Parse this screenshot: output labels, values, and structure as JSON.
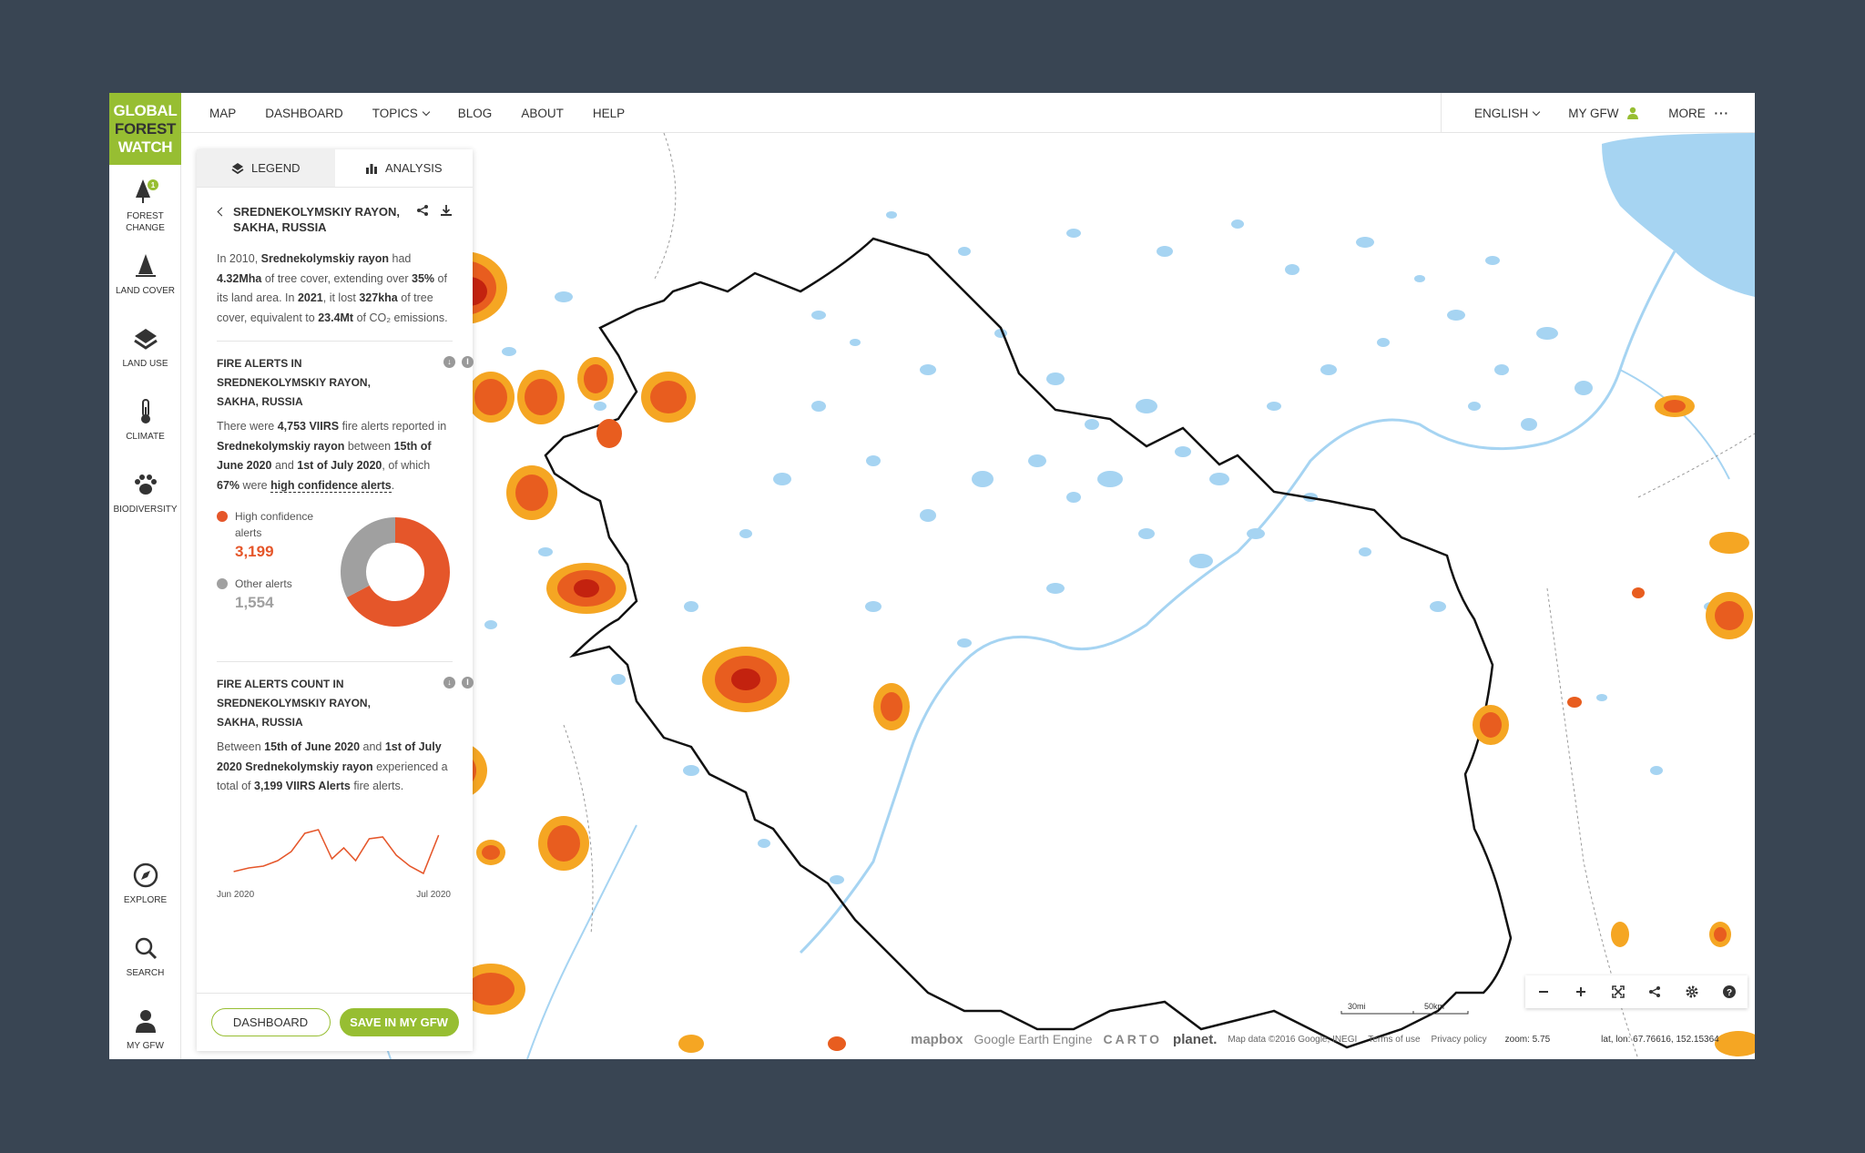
{
  "logo": {
    "line1": "GLOBAL",
    "line2": "FOREST",
    "line3": "WATCH"
  },
  "nav": {
    "links": [
      "MAP",
      "DASHBOARD",
      "TOPICS",
      "BLOG",
      "ABOUT",
      "HELP"
    ],
    "right": {
      "language": "ENGLISH",
      "my_gfw": "MY GFW",
      "more": "MORE"
    }
  },
  "sidebar": {
    "top": [
      {
        "label1": "FOREST",
        "label2": "CHANGE",
        "badge": "1",
        "icon": "tree-icon"
      },
      {
        "label1": "LAND COVER",
        "label2": "",
        "icon": "land-cover-icon"
      },
      {
        "label1": "LAND USE",
        "label2": "",
        "icon": "layers-icon"
      },
      {
        "label1": "CLIMATE",
        "label2": "",
        "icon": "thermometer-icon"
      },
      {
        "label1": "BIODIVERSITY",
        "label2": "",
        "icon": "paw-icon"
      }
    ],
    "bottom": [
      {
        "label": "EXPLORE",
        "icon": "compass-icon"
      },
      {
        "label": "SEARCH",
        "icon": "search-icon"
      },
      {
        "label": "MY GFW",
        "icon": "user-icon"
      }
    ]
  },
  "panel": {
    "tabs": {
      "legend": "LEGEND",
      "analysis": "ANALYSIS"
    },
    "location": {
      "line1": "SREDNEKOLYMSKIY RAYON,",
      "line2": "SAKHA, RUSSIA"
    },
    "summary": {
      "t1": "In 2010, ",
      "b1": "Srednekolymskiy rayon",
      "t2": " had ",
      "b2": "4.32Mha",
      "t3": " of tree cover, extending over ",
      "b3": "35%",
      "t4": " of its land area. In ",
      "b4": "2021",
      "t5": ", it lost ",
      "b5": "327kha",
      "t6": " of tree cover, equivalent to ",
      "b6": "23.4Mt",
      "t7": " of CO₂ emissions."
    },
    "fire_alerts": {
      "title": "FIRE ALERTS IN SREDNEKOLYMSKIY RAYON, SAKHA, RUSSIA",
      "t1": "There were ",
      "b1": "4,753 VIIRS",
      "t2": " fire alerts reported in ",
      "b2": "Srednekolymskiy rayon",
      "t3": " between ",
      "b3": "15th of June 2020",
      "t4": " and ",
      "b4": "1st of July 2020",
      "t5": ", of which ",
      "b5": "67%",
      "t6": " were ",
      "b6": "high confidence alerts",
      "t7": ".",
      "legend": {
        "high_label_1": "High confidence",
        "high_label_2": "alerts",
        "high_value": "3,199",
        "other_label": "Other alerts",
        "other_value": "1,554"
      },
      "donut": {
        "high": 3199,
        "other": 1554
      }
    },
    "fire_count": {
      "title": "FIRE ALERTS COUNT IN SREDNEKOLYMSKIY RAYON, SAKHA, RUSSIA",
      "t1": "Between ",
      "b1": "15th of June 2020",
      "t2": " and ",
      "b2": "1st of July 2020 Srednekolymskiy rayon",
      "t3": " experienced a total of ",
      "r1": "3,199",
      "b3": "VIIRS Alerts",
      "t4": " fire alerts.",
      "x_start": "Jun 2020",
      "x_end": "Jul 2020"
    },
    "buttons": {
      "dashboard": "DASHBOARD",
      "save": "SAVE IN MY GFW"
    }
  },
  "map": {
    "attribution": {
      "mapbox": "mapbox",
      "gee": "Google Earth Engine",
      "carto": "CARTO",
      "planet": "planet.",
      "data": "Map data ©2016 Google, INEGI",
      "terms": "Terms of use",
      "privacy": "Privacy policy",
      "zoom": "zoom: 5.75",
      "latlon": "lat, lon: 67.76616, 152.15364"
    },
    "scale": {
      "mi": "30mi",
      "km": "50km"
    }
  },
  "colors": {
    "brand": "#97be32",
    "alert": "#e5562a",
    "other": "#a0a0a0",
    "water": "#a6d4f2"
  }
}
